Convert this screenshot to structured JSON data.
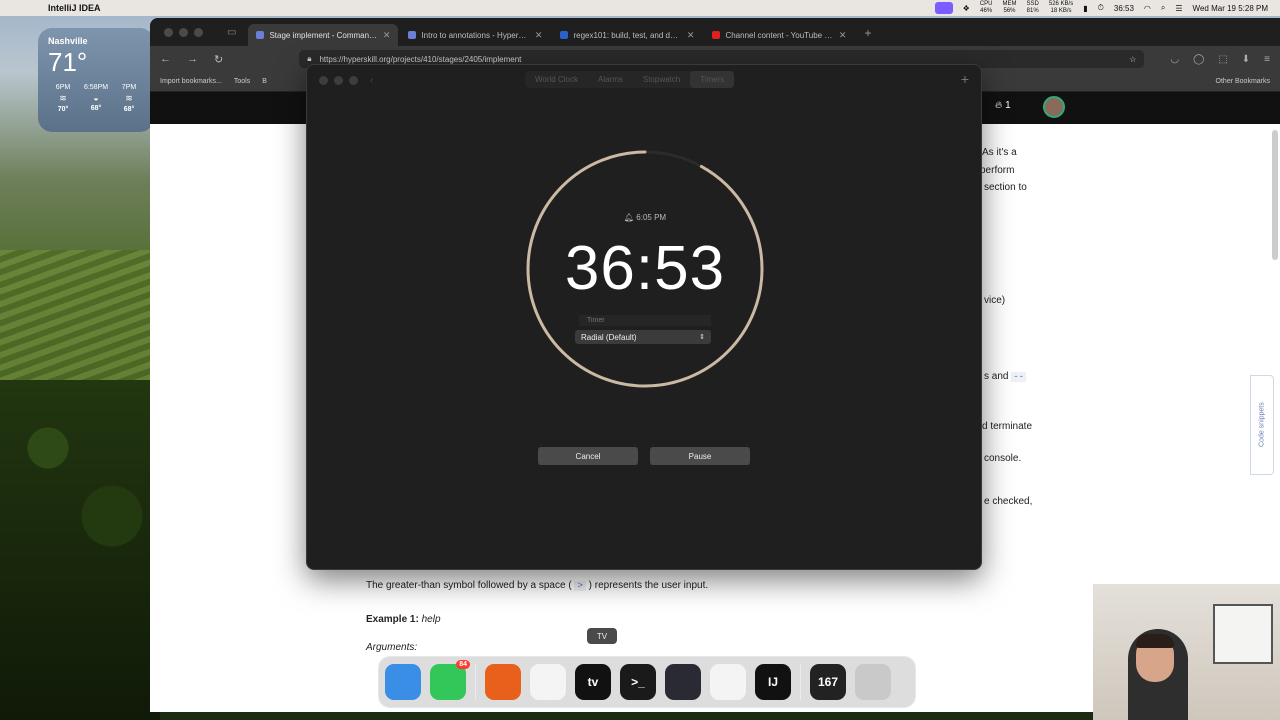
{
  "menubar": {
    "app_name": "IntelliJ IDEA",
    "stats": [
      {
        "top": "CPU",
        "bottom": "46%"
      },
      {
        "top": "MEM",
        "bottom": "56%"
      },
      {
        "top": "SSD",
        "bottom": "81%"
      },
      {
        "top": "526 KB/s",
        "bottom": "18 KB/s"
      }
    ],
    "time": "36:53",
    "datetime": "Wed Mar 19  5:28 PM"
  },
  "weather": {
    "city": "Nashville",
    "temp": "71°",
    "hours": [
      {
        "time": "6PM",
        "icon": "wind-icon",
        "temp": "70°"
      },
      {
        "time": "6:58PM",
        "icon": "sunset-icon",
        "temp": "68°"
      },
      {
        "time": "7PM",
        "icon": "wind-icon",
        "temp": "68°"
      }
    ]
  },
  "browser": {
    "tabs": [
      {
        "title": "Stage implement - Command line",
        "active": true
      },
      {
        "title": "Intro to annotations - Hyperskill",
        "active": false
      },
      {
        "title": "regex101: build, test, and debug",
        "active": false
      },
      {
        "title": "Channel content - YouTube Studio",
        "active": false
      }
    ],
    "url": "https://hyperskill.org/projects/410/stages/2405/implement",
    "bookmarks": [
      "Import bookmarks...",
      "Tools",
      "B"
    ],
    "other_bookmarks": "Other Bookmarks"
  },
  "page": {
    "streak": "1",
    "side_panel_label": "Code snippets",
    "fragments": [
      "As it's a",
      "perform",
      "section to",
      "vice)",
      "s and",
      "d terminate",
      "console.",
      "e checked,"
    ],
    "fragment_code": "--",
    "input_line_before": "The greater-than symbol followed by a space (",
    "input_line_code": ">",
    "input_line_after": ") represents the user input.",
    "example_label": "Example 1:",
    "example_value": "help",
    "arguments_label": "Arguments:"
  },
  "clock_app": {
    "tabs": [
      "World Clock",
      "Alarms",
      "Stopwatch",
      "Timers"
    ],
    "active_tab": "Timers",
    "alarm_time": "6:05 PM",
    "timer_digits": "36:53",
    "timer_label_placeholder": "Timer",
    "style_select": "Radial (Default)",
    "cancel_label": "Cancel",
    "pause_label": "Pause",
    "progress_remaining": 0.92,
    "ring_color": "#cbb9a3"
  },
  "dock": {
    "tooltip": "TV",
    "items": [
      {
        "name": "finder-icon",
        "label": "",
        "color": "#3a8ee6"
      },
      {
        "name": "messages-icon",
        "label": "",
        "color": "#33c75a",
        "badge": "84"
      },
      {
        "name": "firefox-icon",
        "label": "",
        "color": "#e8601c"
      },
      {
        "name": "chatgpt-icon",
        "label": "",
        "color": "#f4f4f4"
      },
      {
        "name": "apple-tv-icon",
        "label": "tv",
        "color": "#111111"
      },
      {
        "name": "terminal-icon",
        "label": ">_",
        "color": "#1a1a1a"
      },
      {
        "name": "obs-icon",
        "label": "",
        "color": "#2a2a35"
      },
      {
        "name": "clock-icon",
        "label": "",
        "color": "#f4f4f4"
      },
      {
        "name": "intellij-icon",
        "label": "IJ",
        "color": "#111111"
      },
      {
        "name": "calendar-icon",
        "label": "167",
        "color": "#222222"
      },
      {
        "name": "trash-icon",
        "label": "",
        "color": "#c9c9c9"
      }
    ]
  }
}
